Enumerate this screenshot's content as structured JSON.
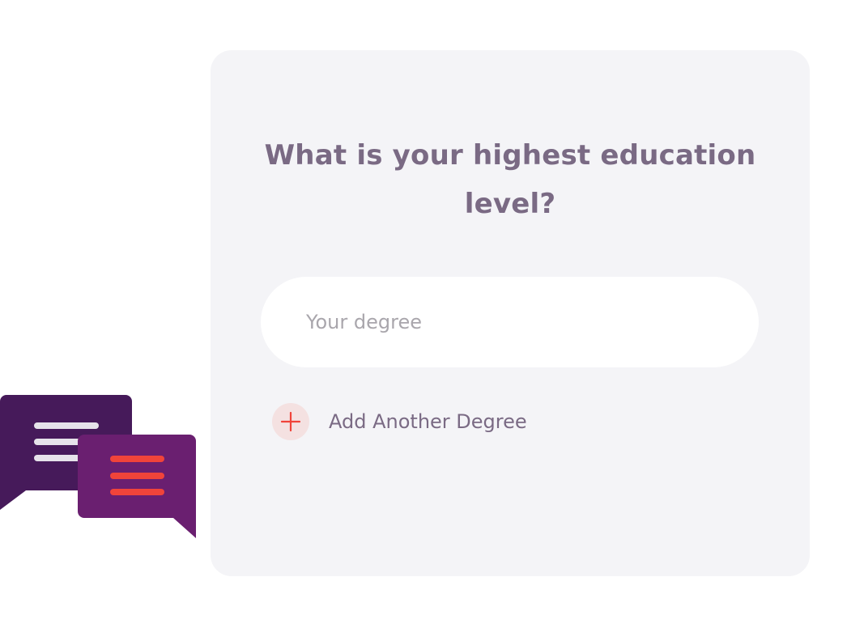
{
  "question": {
    "title": "What is your highest education level?"
  },
  "degree_input": {
    "placeholder": "Your degree",
    "value": ""
  },
  "add_degree": {
    "label": "Add Another Degree",
    "icon": "plus-icon"
  },
  "illustration": {
    "icon": "chat-bubbles-icon"
  },
  "colors": {
    "card_background": "#f4f4f7",
    "heading_text": "#7a6a84",
    "placeholder_text": "#a9a6ac",
    "accent_red": "#f0443a",
    "plus_circle_bg": "#f4e1e1",
    "bubble_dark_purple": "#461a5a",
    "bubble_purple": "#6a1f70"
  }
}
